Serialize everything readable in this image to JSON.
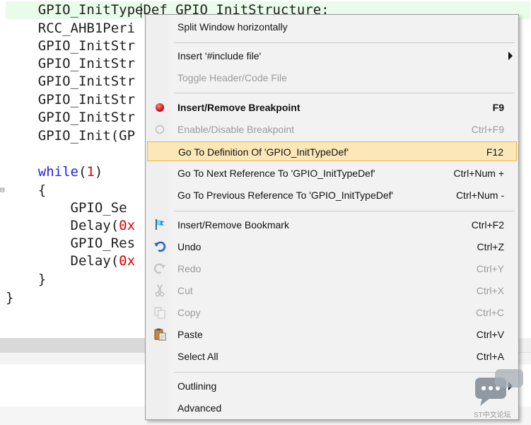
{
  "editor": {
    "lines": [
      {
        "pre": "    ",
        "text": "GPIO_InitTypeDef GPIO_InitStructure;"
      },
      {
        "pre": "    ",
        "text": "RCC_AHB1Peri"
      },
      {
        "pre": "    ",
        "text": "GPIO_InitStr"
      },
      {
        "pre": "    ",
        "text": "GPIO_InitStr"
      },
      {
        "pre": "    ",
        "text": "GPIO_InitStr"
      },
      {
        "pre": "    ",
        "text": "GPIO_InitStr"
      },
      {
        "pre": "    ",
        "text": "GPIO_InitStr"
      },
      {
        "pre": "    ",
        "text": "GPIO_Init(GP"
      },
      {
        "pre": "",
        "text": ""
      },
      {
        "pre": "    ",
        "kw": "while",
        "open": "(",
        "num": "1",
        "close": ")"
      },
      {
        "pre": "    ",
        "text": "{"
      },
      {
        "pre": "        ",
        "text": "GPIO_Se"
      },
      {
        "pre": "        ",
        "text": "Delay(",
        "num": "0x"
      },
      {
        "pre": "        ",
        "text": "GPIO_Res"
      },
      {
        "pre": "        ",
        "text": "Delay(",
        "num": "0x"
      },
      {
        "pre": "    ",
        "text": "}"
      },
      {
        "pre": "",
        "text": "}"
      }
    ],
    "fold_marker": "⊟"
  },
  "context_menu": {
    "items": [
      {
        "label": "Split Window horizontally",
        "shortcut": ""
      },
      {
        "label": "Insert '#include file'",
        "shortcut": "",
        "submenu": true
      },
      {
        "label": "Toggle Header/Code File",
        "shortcut": "",
        "disabled": true
      },
      {
        "label": "Insert/Remove Breakpoint",
        "shortcut": "F9",
        "bold": true,
        "icon": "breakpoint-icon"
      },
      {
        "label": "Enable/Disable Breakpoint",
        "shortcut": "Ctrl+F9",
        "disabled": true,
        "icon": "breakpoint-toggle-icon"
      },
      {
        "label": "Go To Definition Of 'GPIO_InitTypeDef'",
        "shortcut": "F12",
        "highlighted": true
      },
      {
        "label": "Go To Next Reference To 'GPIO_InitTypeDef'",
        "shortcut": "Ctrl+Num +"
      },
      {
        "label": "Go To Previous Reference To 'GPIO_InitTypeDef'",
        "shortcut": "Ctrl+Num -"
      },
      {
        "label": "Insert/Remove Bookmark",
        "shortcut": "Ctrl+F2",
        "icon": "bookmark-flag-icon"
      },
      {
        "label": "Undo",
        "shortcut": "Ctrl+Z",
        "icon": "undo-icon"
      },
      {
        "label": "Redo",
        "shortcut": "Ctrl+Y",
        "disabled": true,
        "icon": "redo-icon"
      },
      {
        "label": "Cut",
        "shortcut": "Ctrl+X",
        "disabled": true,
        "icon": "scissors-icon"
      },
      {
        "label": "Copy",
        "shortcut": "Ctrl+C",
        "disabled": true,
        "icon": "copy-icon"
      },
      {
        "label": "Paste",
        "shortcut": "Ctrl+V",
        "icon": "paste-icon"
      },
      {
        "label": "Select All",
        "shortcut": "Ctrl+A"
      },
      {
        "label": "Outlining",
        "shortcut": "",
        "submenu": true
      },
      {
        "label": "Advanced",
        "shortcut": ""
      }
    ]
  },
  "watermark": {
    "text": "ST中文论坛",
    "icon": "chat-bubble-icon"
  },
  "colors": {
    "menu_background": "#f2f2f2",
    "highlight_fill": "#fbe7b8",
    "highlight_border": "#e6b84a",
    "keyword": "#2222ee",
    "number": "#e00000",
    "current_line": "#e9fbe9"
  }
}
